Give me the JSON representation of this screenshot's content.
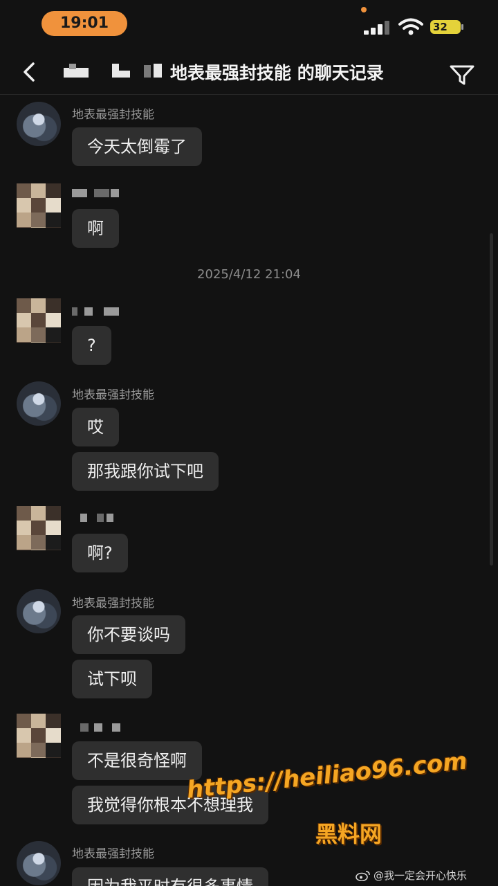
{
  "status_bar": {
    "time": "19:01",
    "battery": "32"
  },
  "header": {
    "title": "地表最强封技能 的聊天记录"
  },
  "chat": {
    "timestamp": "2025/4/12 21:04",
    "sender_name": "地表最强封技能",
    "messages": [
      {
        "sender": "other",
        "text": "今天太倒霉了"
      },
      {
        "sender": "me",
        "text": "啊"
      },
      {
        "sender": "me",
        "text": "?"
      },
      {
        "sender": "other",
        "text": "哎"
      },
      {
        "sender": "other",
        "text": "那我跟你试下吧"
      },
      {
        "sender": "me",
        "text": "啊?"
      },
      {
        "sender": "other",
        "text": "你不要谈吗"
      },
      {
        "sender": "other",
        "text": "试下呗"
      },
      {
        "sender": "me",
        "text": "不是很奇怪啊"
      },
      {
        "sender": "me",
        "text": "我觉得你根本不想理我"
      },
      {
        "sender": "other",
        "text": "因为我平时有很多事情"
      }
    ]
  },
  "watermark": {
    "url": "https://heiliao96.com",
    "site_name": "黑料网",
    "weibo": "@我一定会开心快乐"
  },
  "colors": {
    "accent": "#f0923c",
    "bubble": "#2f2f2f",
    "background": "#121212",
    "watermark": "#f5a623"
  }
}
